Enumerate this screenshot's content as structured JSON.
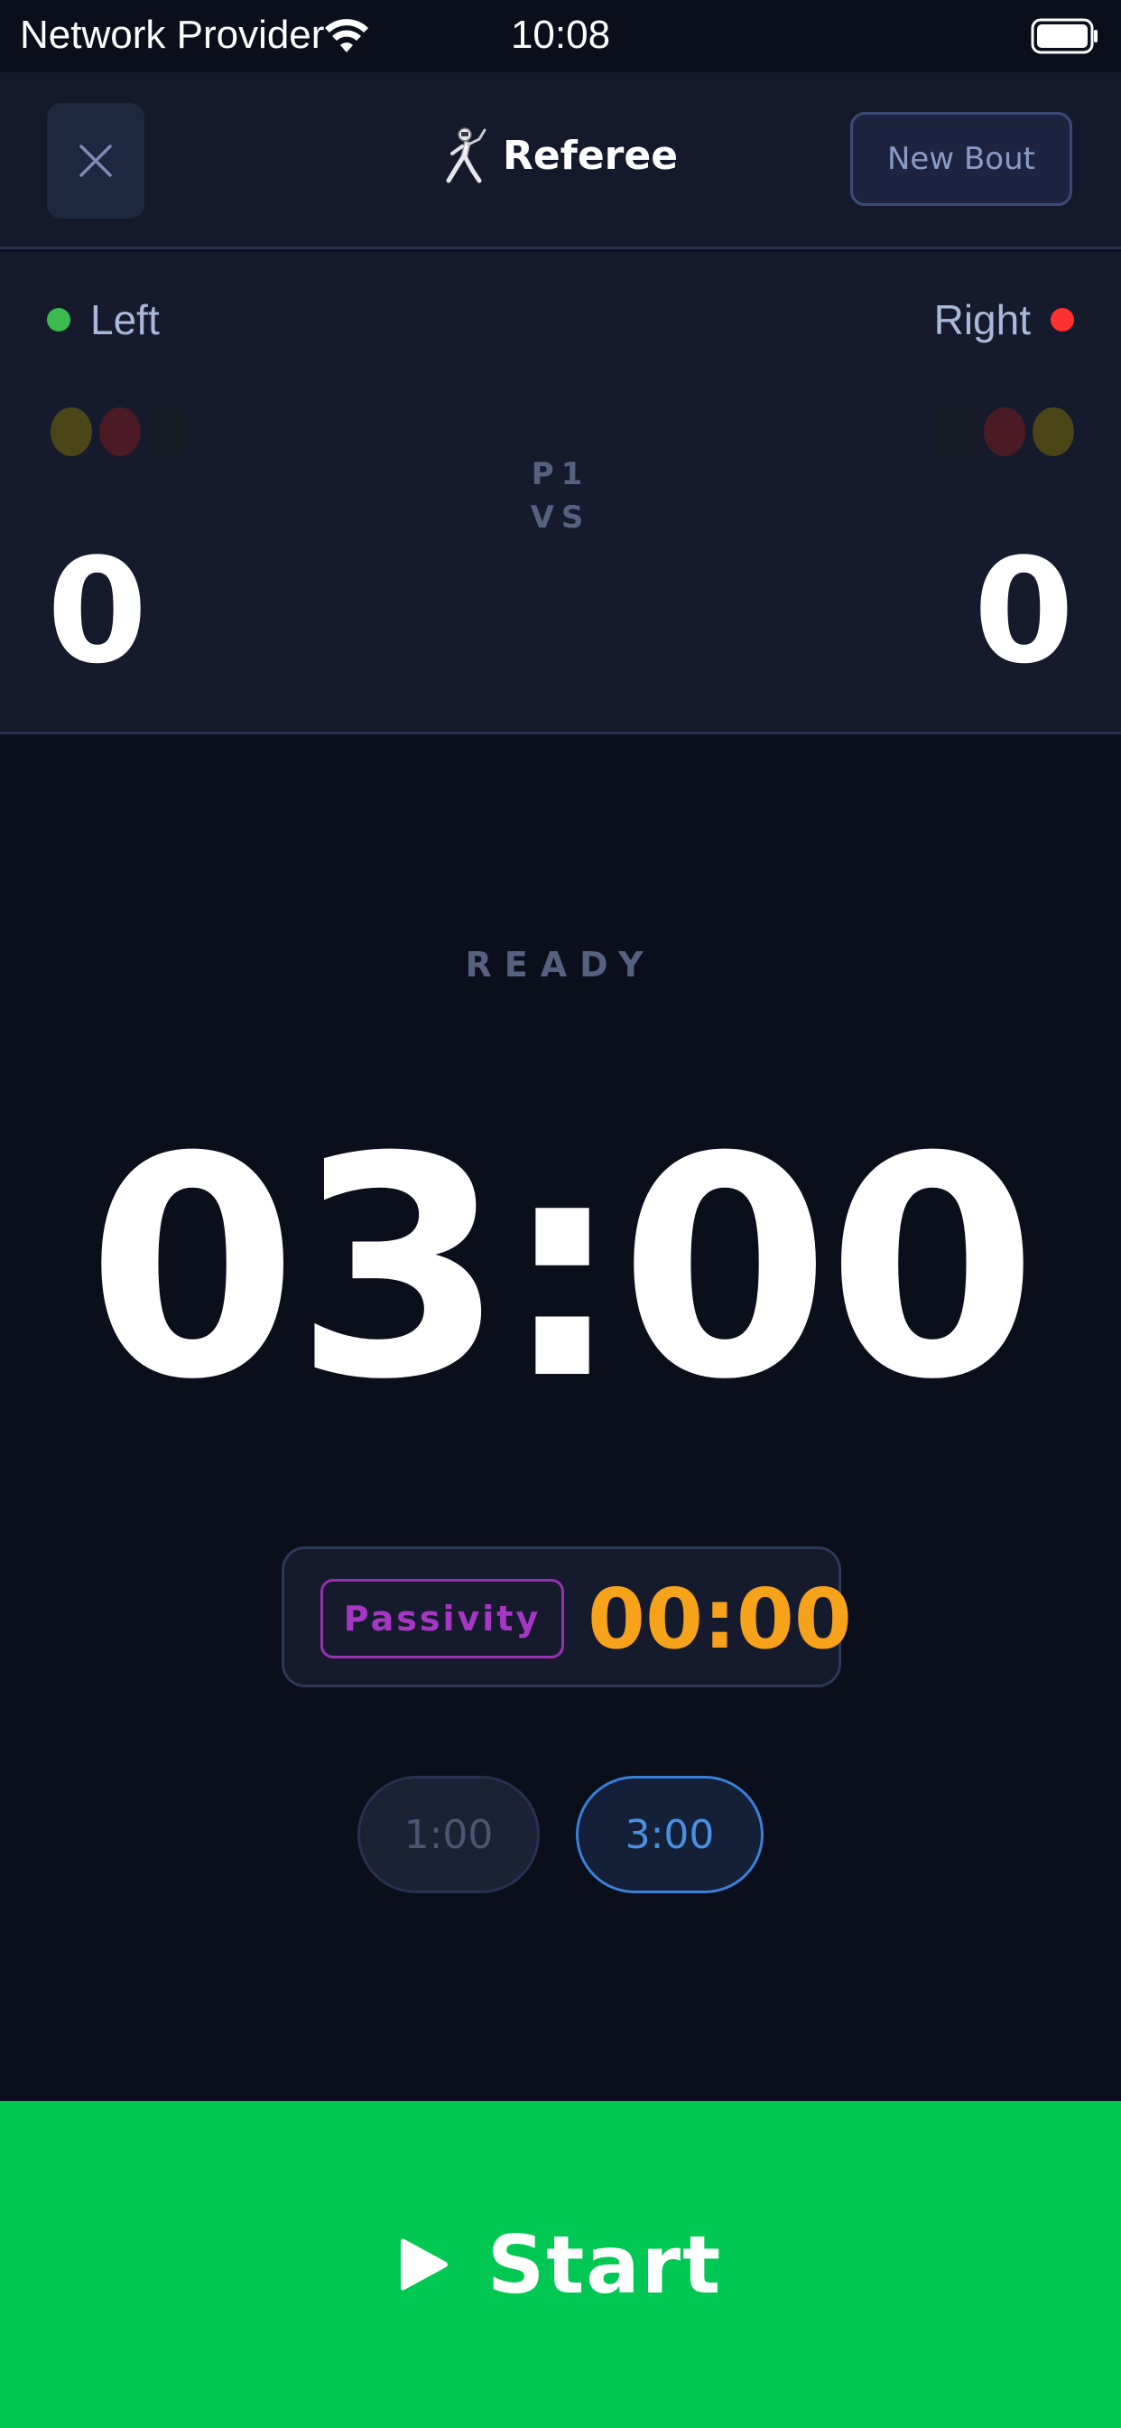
{
  "status_bar": {
    "carrier": "Network Provider",
    "time": "10:08",
    "icons": [
      "wifi-icon",
      "battery-icon"
    ]
  },
  "header": {
    "close_icon": "close-icon",
    "title_icon": "fencer-icon",
    "title": "Referee",
    "new_bout_label": "New Bout"
  },
  "scoreboard": {
    "left": {
      "label": "Left",
      "score": "0",
      "indicator_color": "#3dba4e",
      "cards": [
        "yellow",
        "red",
        "black"
      ]
    },
    "right": {
      "label": "Right",
      "score": "0",
      "indicator_color": "#ff3030",
      "cards": [
        "black",
        "red",
        "yellow"
      ]
    },
    "period": "P1",
    "vs": "VS"
  },
  "timer": {
    "state": "READY",
    "value": "03:00"
  },
  "passivity": {
    "label": "Passivity",
    "value": "00:00"
  },
  "presets": [
    {
      "label": "1:00",
      "selected": false
    },
    {
      "label": "3:00",
      "selected": true
    }
  ],
  "start": {
    "icon": "play-icon",
    "label": "Start"
  },
  "colors": {
    "background": "#0b0f1c",
    "panel": "#151b2d",
    "start_green": "#00c853",
    "passivity_purple": "#a637c4",
    "passivity_orange": "#f7a21b",
    "preset_blue": "#4a90e2"
  }
}
